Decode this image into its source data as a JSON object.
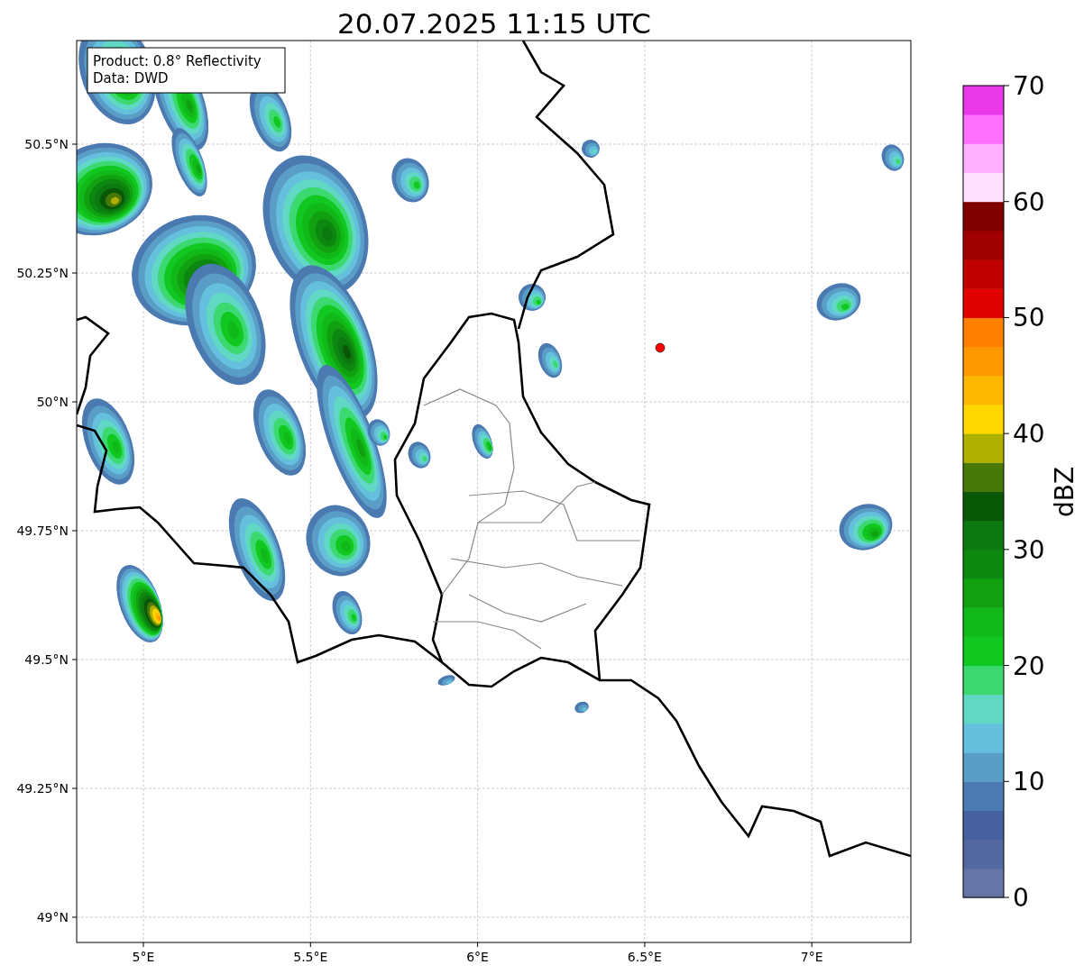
{
  "title": "20.07.2025 11:15 UTC",
  "info_box": {
    "lines": [
      "Product: 0.8° Reflectivity",
      "Data: DWD"
    ]
  },
  "y_tick_labels": [
    "50.5°N",
    "50.25°N",
    "50°N",
    "49.75°N",
    "49.5°N",
    "49.25°N",
    "49°N"
  ],
  "x_tick_labels": [
    "5°E",
    "5.5°E",
    "6°E",
    "6.5°E",
    "7°E"
  ],
  "colorbar": {
    "label": "dBZ",
    "tick_labels": [
      "70",
      "60",
      "50",
      "40",
      "30",
      "20",
      "10",
      "0"
    ],
    "segments": [
      {
        "color": "#6475a6"
      },
      {
        "color": "#5468a0"
      },
      {
        "color": "#4660a0"
      },
      {
        "color": "#4a7ab0"
      },
      {
        "color": "#5a9ec8"
      },
      {
        "color": "#64c0dc"
      },
      {
        "color": "#60d8c4"
      },
      {
        "color": "#3cd870"
      },
      {
        "color": "#10c820"
      },
      {
        "color": "#10b818"
      },
      {
        "color": "#10a010"
      },
      {
        "color": "#0c8810"
      },
      {
        "color": "#0c7810"
      },
      {
        "color": "#085808"
      },
      {
        "color": "#487808"
      },
      {
        "color": "#b0b000"
      },
      {
        "color": "#ffd800"
      },
      {
        "color": "#ffb800"
      },
      {
        "color": "#ff9800"
      },
      {
        "color": "#ff8000"
      },
      {
        "color": "#e00000"
      },
      {
        "color": "#c00000"
      },
      {
        "color": "#a00000"
      },
      {
        "color": "#800000"
      },
      {
        "color": "#ffe0ff"
      },
      {
        "color": "#ffb0ff"
      },
      {
        "color": "#ff70ff"
      },
      {
        "color": "#e838e8"
      }
    ]
  }
}
